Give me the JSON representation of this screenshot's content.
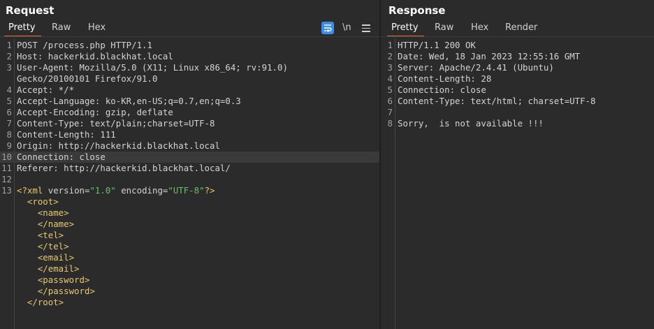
{
  "request": {
    "title": "Request",
    "tabs": [
      "Pretty",
      "Raw",
      "Hex"
    ],
    "newline_toggle": "\\n",
    "lines": [
      {
        "num": "1",
        "text": "POST /process.php HTTP/1.1"
      },
      {
        "num": "2",
        "text": "Host: hackerkid.blackhat.local"
      },
      {
        "num": "3",
        "text": "User-Agent: Mozilla/5.0 (X11; Linux x86_64; rv:91.0)"
      },
      {
        "num": "",
        "text": "Gecko/20100101 Firefox/91.0"
      },
      {
        "num": "4",
        "text": "Accept: */*"
      },
      {
        "num": "5",
        "text": "Accept-Language: ko-KR,en-US;q=0.7,en;q=0.3"
      },
      {
        "num": "6",
        "text": "Accept-Encoding: gzip, deflate"
      },
      {
        "num": "7",
        "text": "Content-Type: text/plain;charset=UTF-8"
      },
      {
        "num": "8",
        "text": "Content-Length: 111"
      },
      {
        "num": "9",
        "text": "Origin: http://hackerkid.blackhat.local"
      },
      {
        "num": "10",
        "text": "Connection: close"
      },
      {
        "num": "11",
        "text": "Referer: http://hackerkid.blackhat.local/"
      },
      {
        "num": "12",
        "text": ""
      },
      {
        "num": "13",
        "text": ""
      }
    ],
    "xml": {
      "decl_open": "<?xml ",
      "version_attr": "version=",
      "version_val": "\"1.0\"",
      "encoding_attr": " encoding=",
      "encoding_val": "\"UTF-8\"",
      "decl_close": "?>",
      "body": [
        {
          "indent": "  ",
          "text": "<root>"
        },
        {
          "indent": "    ",
          "text": "<name>"
        },
        {
          "indent": "    ",
          "text": "</name>"
        },
        {
          "indent": "    ",
          "text": "<tel>"
        },
        {
          "indent": "    ",
          "text": "</tel>"
        },
        {
          "indent": "    ",
          "text": "<email>"
        },
        {
          "indent": "    ",
          "text": "</email>"
        },
        {
          "indent": "    ",
          "text": "<password>"
        },
        {
          "indent": "    ",
          "text": "</password>"
        },
        {
          "indent": "  ",
          "text": "</root>"
        }
      ]
    },
    "highlighted_line": "10"
  },
  "response": {
    "title": "Response",
    "tabs": [
      "Pretty",
      "Raw",
      "Hex",
      "Render"
    ],
    "lines": [
      {
        "num": "1",
        "text": "HTTP/1.1 200 OK"
      },
      {
        "num": "2",
        "text": "Date: Wed, 18 Jan 2023 12:55:16 GMT"
      },
      {
        "num": "3",
        "text": "Server: Apache/2.4.41 (Ubuntu)"
      },
      {
        "num": "4",
        "text": "Content-Length: 28"
      },
      {
        "num": "5",
        "text": "Connection: close"
      },
      {
        "num": "6",
        "text": "Content-Type: text/html; charset=UTF-8"
      },
      {
        "num": "7",
        "text": ""
      },
      {
        "num": "8",
        "text": "Sorry,  is not available !!!"
      }
    ]
  },
  "colors": {
    "background": "#2b2b2b",
    "active_tab_underline": "#e8693c",
    "wrap_button": "#3c8de6",
    "xml_tag": "#e6c872",
    "xml_string": "#66c26a"
  }
}
